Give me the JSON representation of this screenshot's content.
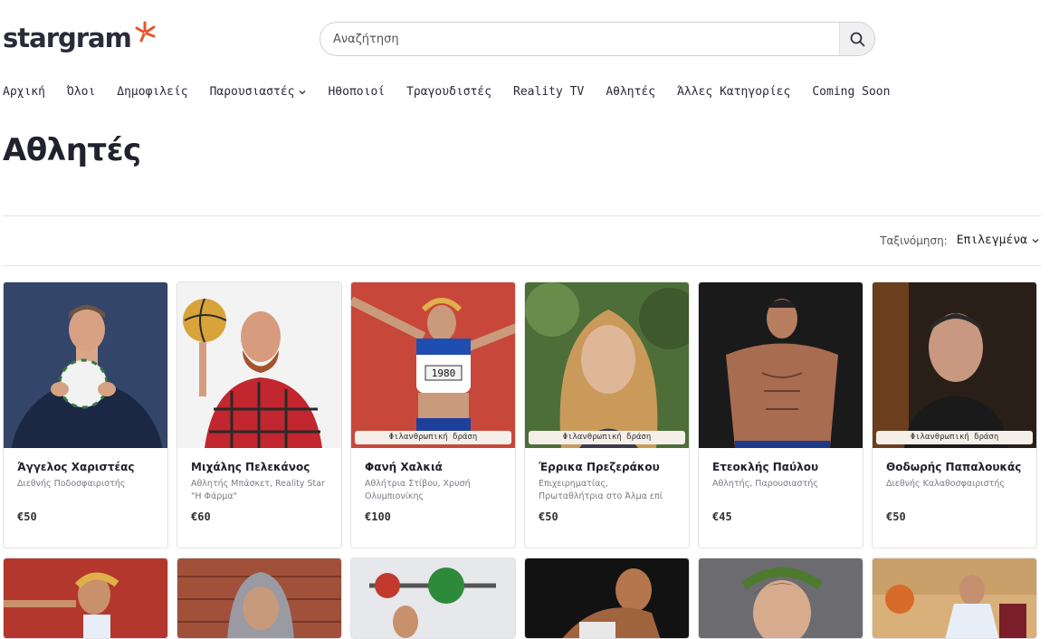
{
  "header": {
    "logo_text": "stargram",
    "search_placeholder": "Αναζήτηση",
    "search_icon": "search-icon"
  },
  "nav": {
    "items": [
      {
        "label": "Αρχική"
      },
      {
        "label": "Όλοι"
      },
      {
        "label": "Δημοφιλείς"
      },
      {
        "label": "Παρουσιαστές",
        "has_dropdown": true
      },
      {
        "label": "Ηθοποιοί"
      },
      {
        "label": "Τραγουδιστές"
      },
      {
        "label": "Reality TV"
      },
      {
        "label": "Αθλητές"
      },
      {
        "label": "Άλλες Κατηγορίες"
      },
      {
        "label": "Coming Soon"
      }
    ]
  },
  "page": {
    "title": "Αθλητές",
    "sort_label": "Ταξινόμηση:",
    "sort_value": "Επιλεγμένα"
  },
  "colors": {
    "accent": "#e8542a",
    "text": "#22222e",
    "badge_bg": "#f4efe9"
  },
  "cards": [
    {
      "name": "Άγγελος Χαριστέας",
      "desc": "Διεθνής Ποδοσφαιριστής",
      "price": "€50",
      "badge": ""
    },
    {
      "name": "Μιχάλης Πελεκάνος",
      "desc": "Αθλητής Μπάσκετ, Reality Star \"Η Φάρμα\"",
      "price": "€60",
      "badge": ""
    },
    {
      "name": "Φανή Χαλκιά",
      "desc": "Αθλήτρια Στίβου, Χρυσή Ολυμπιονίκης",
      "price": "€100",
      "badge": "Φιλανθρωπική δράση"
    },
    {
      "name": "Έρρικα Πρεζεράκου",
      "desc": "Επιχειρηματίας, Πρωταθλήτρια στο Άλμα επί κοντώ",
      "price": "€50",
      "badge": "Φιλανθρωπική δράση"
    },
    {
      "name": "Ετεοκλής Παύλου",
      "desc": "Αθλητής, Παρουσιαστής",
      "price": "€45",
      "badge": ""
    },
    {
      "name": "Θοδωρής Παπαλουκάς",
      "desc": "Διεθνής Καλαθοσφαιριστής",
      "price": "€50",
      "badge": "Φιλανθρωπική δράση"
    }
  ]
}
